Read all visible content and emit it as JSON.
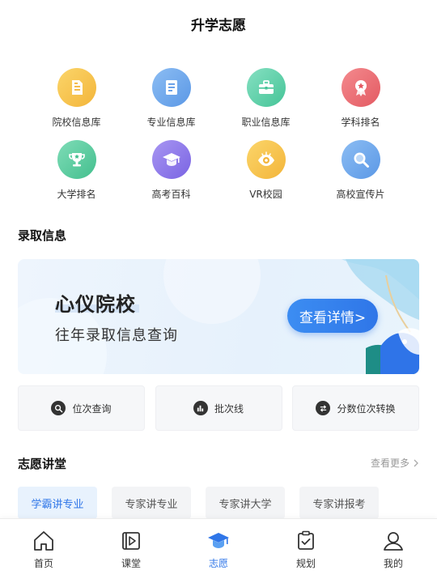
{
  "header": {
    "title": "升学志愿"
  },
  "grid": [
    {
      "label": "院校信息库",
      "icon": "document-icon",
      "color": "#f7c24a"
    },
    {
      "label": "专业信息库",
      "icon": "book-icon",
      "color": "#6fa8ec"
    },
    {
      "label": "职业信息库",
      "icon": "briefcase-icon",
      "color": "#5fd1aa"
    },
    {
      "label": "学科排名",
      "icon": "medal-icon",
      "color": "#ee6f75"
    },
    {
      "label": "大学排名",
      "icon": "trophy-icon",
      "color": "#58c99d"
    },
    {
      "label": "高考百科",
      "icon": "graduation-cap-icon",
      "color": "#8f7cec"
    },
    {
      "label": "VR校园",
      "icon": "eye-icon",
      "color": "#f7c24a"
    },
    {
      "label": "高校宣传片",
      "icon": "magnifier-icon",
      "color": "#6fa8ec"
    }
  ],
  "admission": {
    "section_title": "录取信息",
    "banner": {
      "title": "心仪院校",
      "subtitle": "往年录取信息查询",
      "button": "查看详情>"
    },
    "quick": [
      {
        "label": "位次查询",
        "icon": "search-icon"
      },
      {
        "label": "批次线",
        "icon": "bar-chart-icon"
      },
      {
        "label": "分数位次转换",
        "icon": "swap-icon"
      }
    ]
  },
  "lecture": {
    "section_title": "志愿讲堂",
    "more": "查看更多",
    "tabs": [
      "学霸讲专业",
      "专家讲专业",
      "专家讲大学",
      "专家讲报考"
    ],
    "active_tab": 0
  },
  "tabbar": {
    "items": [
      {
        "label": "首页",
        "icon": "home-icon"
      },
      {
        "label": "课堂",
        "icon": "video-icon"
      },
      {
        "label": "志愿",
        "icon": "graduation-cap-icon"
      },
      {
        "label": "规划",
        "icon": "clipboard-check-icon"
      },
      {
        "label": "我的",
        "icon": "user-icon"
      }
    ],
    "active": 2,
    "accent": "#2f76e8"
  }
}
